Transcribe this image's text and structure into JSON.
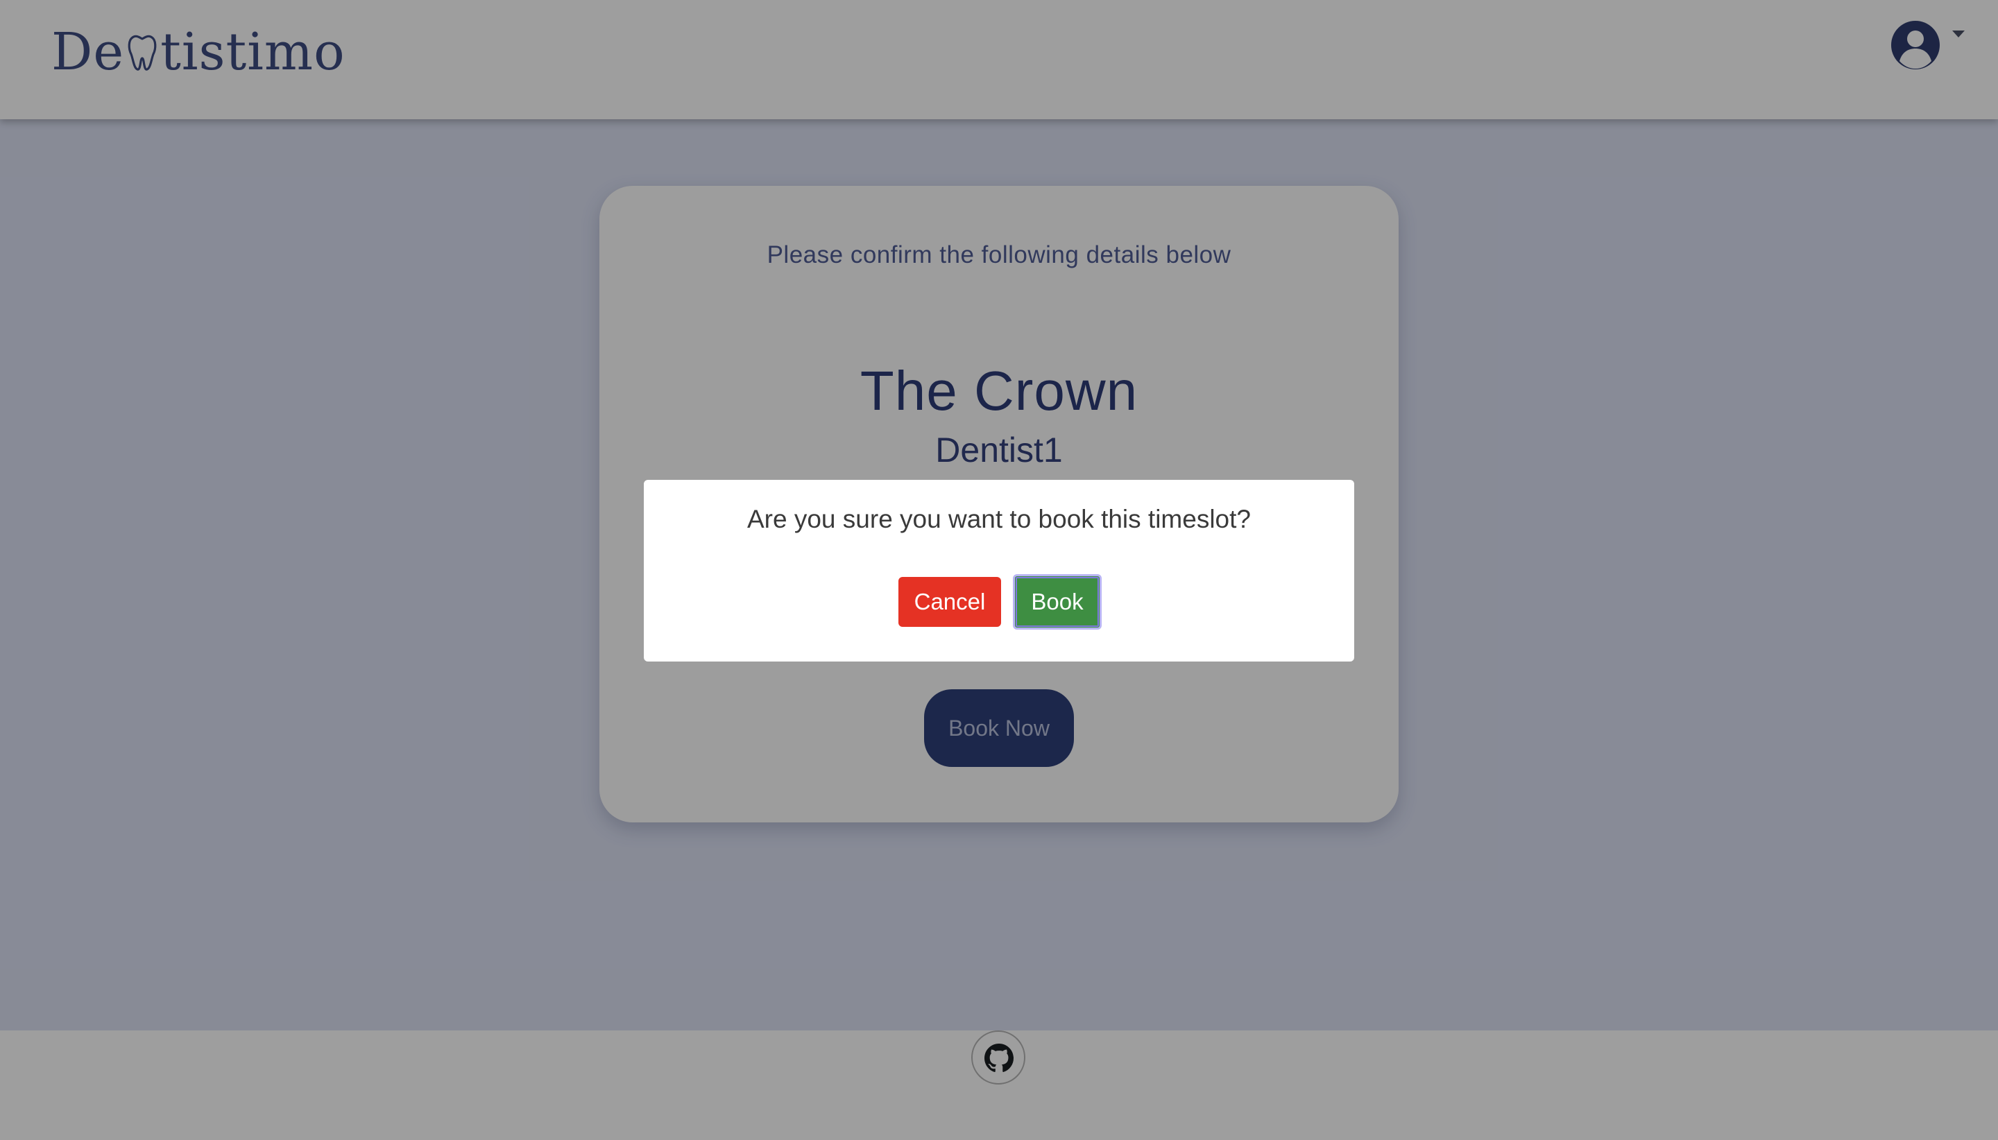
{
  "header": {
    "brand_prefix": "De",
    "brand_suffix": "tistimo",
    "brand_icon": "tooth-icon",
    "profile_icon": "user-avatar-icon",
    "profile_menu_icon": "caret-down-icon"
  },
  "booking_card": {
    "subtitle": "Please confirm the following details below",
    "clinic_name": "The Crown",
    "dentist_name": "Dentist1",
    "book_now_label": "Book Now"
  },
  "dialog": {
    "message": "Are you sure you want to book this timeslot?",
    "cancel_label": "Cancel",
    "book_label": "Book"
  },
  "footer": {
    "github_icon": "github-icon"
  },
  "colors": {
    "brand_blue": "#3e4c82",
    "page_background": "#dbe0f3",
    "cancel_red": "#e53224",
    "book_green": "#3e8e42",
    "book_now_navy": "#2e3f79"
  }
}
